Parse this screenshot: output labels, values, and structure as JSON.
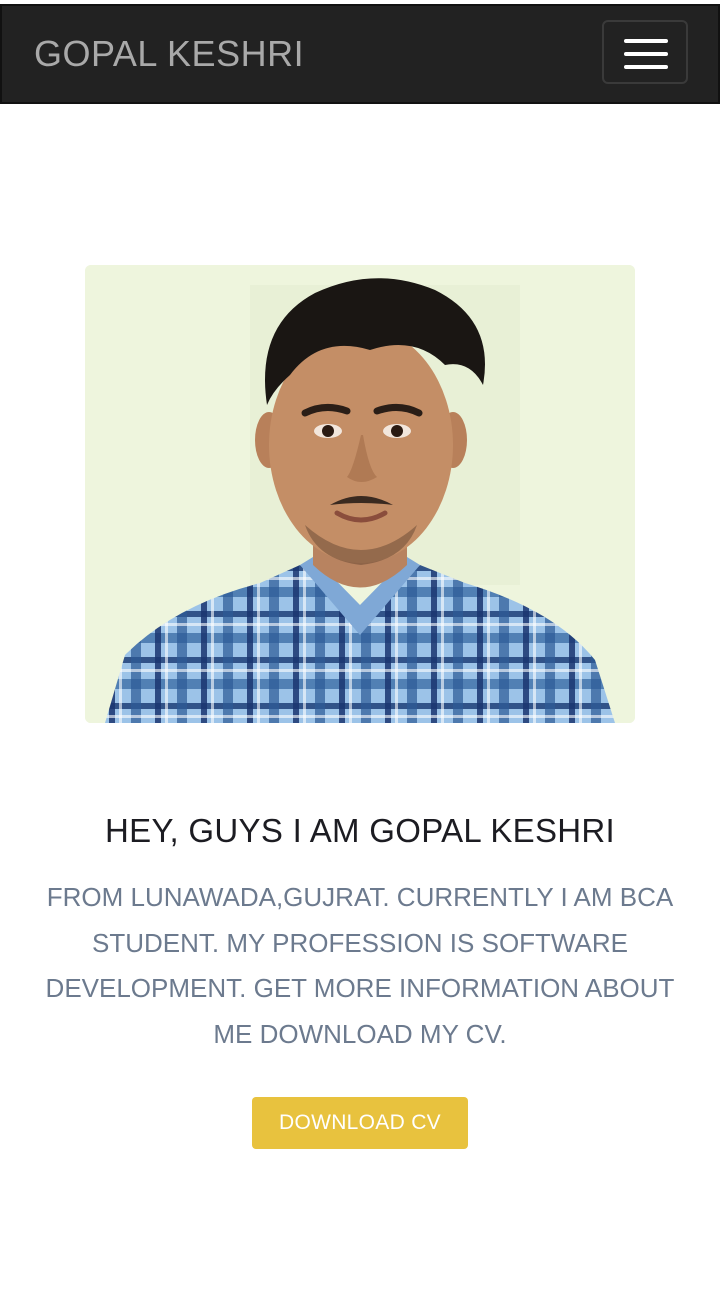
{
  "navbar": {
    "brand": "GOPAL KESHRI",
    "menu_icon": "hamburger-menu-icon"
  },
  "hero": {
    "photo_icon": "profile-photo",
    "headline": "HEY, GUYS I AM GOPAL KESHRI",
    "bio": "FROM LUNAWADA,GUJRAT. CURRENTLY I AM BCA STUDENT. MY PROFESSION IS SOFTWARE DEVELOPMENT. GET MORE INFORMATION ABOUT ME DOWNLOAD MY CV.",
    "cv_button": "DOWNLOAD CV"
  },
  "colors": {
    "navbar_bg": "#222222",
    "brand_text": "#a9a9a9",
    "headline_text": "#1c1c22",
    "bio_text": "#6c7a8e",
    "button_bg": "#e8c23e",
    "button_text": "#ffffff"
  }
}
